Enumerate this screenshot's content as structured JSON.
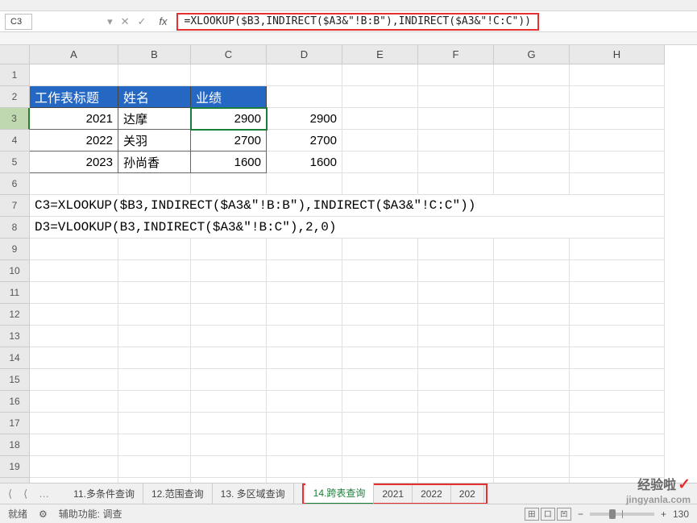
{
  "nameBox": "C3",
  "formula": "=XLOOKUP($B3,INDIRECT($A3&\"!B:B\"),INDIRECT($A3&\"!C:C\"))",
  "columns": [
    "A",
    "B",
    "C",
    "D",
    "E",
    "F",
    "G",
    "H"
  ],
  "rowCount": 20,
  "activeRow": 3,
  "headers": {
    "A": "工作表标题",
    "B": "姓名",
    "C": "业绩"
  },
  "tableRows": [
    {
      "A": "2021",
      "B": "达摩",
      "C": "2900",
      "D": "2900"
    },
    {
      "A": "2022",
      "B": "关羽",
      "C": "2700",
      "D": "2700"
    },
    {
      "A": "2023",
      "B": "孙尚香",
      "C": "1600",
      "D": "1600"
    }
  ],
  "formulaLines": {
    "r7": "C3=XLOOKUP($B3,INDIRECT($A3&\"!B:B\"),INDIRECT($A3&\"!C:C\"))",
    "r8": "D3=VLOOKUP(B3,INDIRECT($A3&\"!B:C\"),2,0)"
  },
  "tabs": {
    "nav": {
      "first": "⟨",
      "prev": "⟨",
      "dots": "…"
    },
    "list": [
      "11.多条件查询",
      "12.范围查询",
      "13. 多区域查询"
    ],
    "highlighted": [
      "14.跨表查询",
      "2021",
      "2022",
      "202"
    ],
    "activeIndex": 0
  },
  "statusBar": {
    "ready": "就绪",
    "helper": "辅助功能: 调查",
    "zoom": "130"
  },
  "watermark": {
    "title": "经验啦",
    "url": "jingyanla.com"
  }
}
